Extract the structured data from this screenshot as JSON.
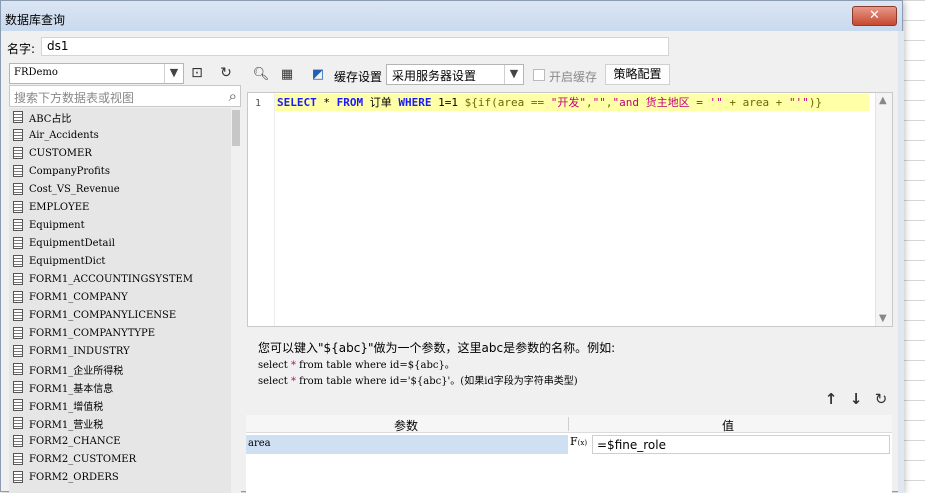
{
  "window": {
    "title": "数据库查询",
    "close_label": "✕"
  },
  "name_field": {
    "label": "名字:",
    "value": "ds1"
  },
  "left": {
    "connection": "FRDemo",
    "search_placeholder": "搜索下方数据表或视图",
    "tables": [
      "ABC占比",
      "Air_Accidents",
      "CUSTOMER",
      "CompanyProfits",
      "Cost_VS_Revenue",
      "EMPLOYEE",
      "Equipment",
      "EquipmentDetail",
      "EquipmentDict",
      "FORM1_ACCOUNTINGSYSTEM",
      "FORM1_COMPANY",
      "FORM1_COMPANYLICENSE",
      "FORM1_COMPANYTYPE",
      "FORM1_INDUSTRY",
      "FORM1_企业所得税",
      "FORM1_基本信息",
      "FORM1_增值税",
      "FORM1_营业税",
      "FORM2_CHANCE",
      "FORM2_CUSTOMER",
      "FORM2_ORDERS"
    ]
  },
  "toolbar": {
    "cache_label": "缓存设置",
    "cache_value": "采用服务器设置",
    "enable_cache_label": "开启缓存",
    "strategy_button": "策略配置"
  },
  "editor": {
    "line_number": "1",
    "tokens": [
      {
        "t": "SELECT",
        "c": "kw"
      },
      {
        "t": " * ",
        "c": "tok-plain"
      },
      {
        "t": "FROM",
        "c": "kw"
      },
      {
        "t": " 订单 ",
        "c": "tok-plain"
      },
      {
        "t": "WHERE",
        "c": "kw"
      },
      {
        "t": " 1=1  ",
        "c": "tok-plain"
      },
      {
        "t": "${if(area == ",
        "c": "tok-fn"
      },
      {
        "t": "\"开发\"",
        "c": "tok-str"
      },
      {
        "t": ",",
        "c": "tok-fn"
      },
      {
        "t": "\"\"",
        "c": "tok-str"
      },
      {
        "t": ",",
        "c": "tok-fn"
      },
      {
        "t": "\"and 货主地区 = '\"",
        "c": "tok-str"
      },
      {
        "t": " + area + ",
        "c": "tok-fn"
      },
      {
        "t": "\"'\"",
        "c": "tok-str"
      },
      {
        "t": ")}",
        "c": "tok-fn"
      }
    ]
  },
  "help": {
    "line1": "您可以键入\"${abc}\"做为一个参数，这里abc是参数的名称。例如:",
    "line2_a": "select ",
    "line2_star": "*",
    "line2_b": " from table where id=${abc}。",
    "line3_a": "select ",
    "line3_star": "*",
    "line3_b": " from table where id='${abc}'。(如果id字段为字符串类型)"
  },
  "params": {
    "col_param": "参数",
    "col_value": "值",
    "rows": [
      {
        "name": "area",
        "value": "=$fine_role"
      }
    ]
  }
}
